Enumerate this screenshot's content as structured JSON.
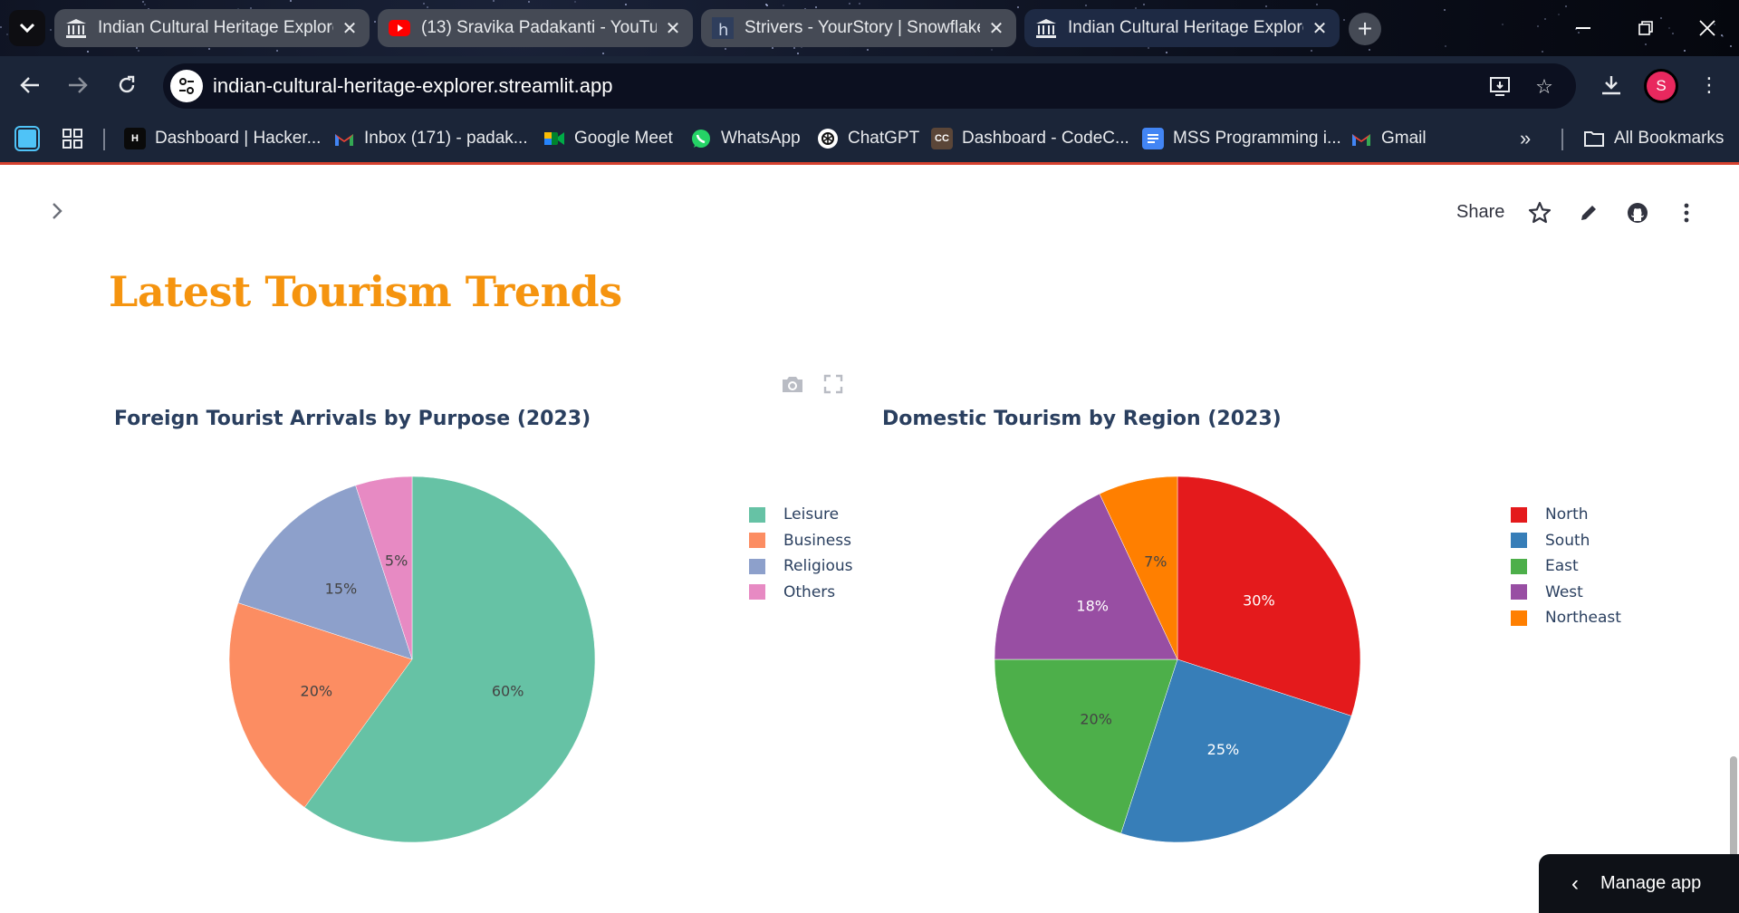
{
  "browser": {
    "tabs": [
      {
        "title": "Indian Cultural Heritage Explore",
        "icon": "museum-icon",
        "active": false
      },
      {
        "title": "(13) Sravika Padakanti - YouTub",
        "icon": "youtube-icon",
        "active": false
      },
      {
        "title": "Strivers - YourStory | Snowflake",
        "icon": "h-logo-icon",
        "active": false
      },
      {
        "title": "Indian Cultural Heritage Explore",
        "icon": "museum-icon",
        "active": true
      }
    ],
    "url": "indian-cultural-heritage-explorer.streamlit.app",
    "profile_initial": "S",
    "bookmarks": [
      {
        "label": "Dashboard | Hacker...",
        "icon": "hackerrank-icon"
      },
      {
        "label": "Inbox (171) - padak...",
        "icon": "gmail-icon"
      },
      {
        "label": "Google Meet",
        "icon": "google-meet-icon"
      },
      {
        "label": "WhatsApp",
        "icon": "whatsapp-icon"
      },
      {
        "label": "ChatGPT",
        "icon": "chatgpt-icon"
      },
      {
        "label": "Dashboard - CodeC...",
        "icon": "codechef-icon"
      },
      {
        "label": "MSS Programming i...",
        "icon": "docs-icon"
      },
      {
        "label": "Gmail",
        "icon": "gmail-icon"
      }
    ],
    "all_bookmarks_label": "All Bookmarks"
  },
  "app": {
    "share_label": "Share",
    "page_title": "Latest Tourism Trends",
    "manage_label": "Manage app"
  },
  "colors": {
    "title_orange": "#f5940f",
    "streamlit_dark": "#0e1117"
  },
  "chart_data": [
    {
      "type": "pie",
      "title": "Foreign Tourist Arrivals by Purpose (2023)",
      "categories": [
        "Leisure",
        "Business",
        "Religious",
        "Others"
      ],
      "values": [
        60,
        20,
        15,
        5
      ],
      "colors": [
        "#66c2a5",
        "#fc8d62",
        "#8da0cb",
        "#e78ac3"
      ],
      "label_colors": [
        "#444444",
        "#444444",
        "#444444",
        "#444444"
      ],
      "legend": "right"
    },
    {
      "type": "pie",
      "title": "Domestic Tourism by Region (2023)",
      "categories": [
        "North",
        "South",
        "East",
        "West",
        "Northeast"
      ],
      "values": [
        30,
        25,
        20,
        18,
        7
      ],
      "colors": [
        "#e41a1c",
        "#377eb8",
        "#4daf4a",
        "#984ea3",
        "#ff7f00"
      ],
      "label_colors": [
        "#ffffff",
        "#ffffff",
        "#444444",
        "#ffffff",
        "#444444"
      ],
      "legend": "right"
    }
  ]
}
